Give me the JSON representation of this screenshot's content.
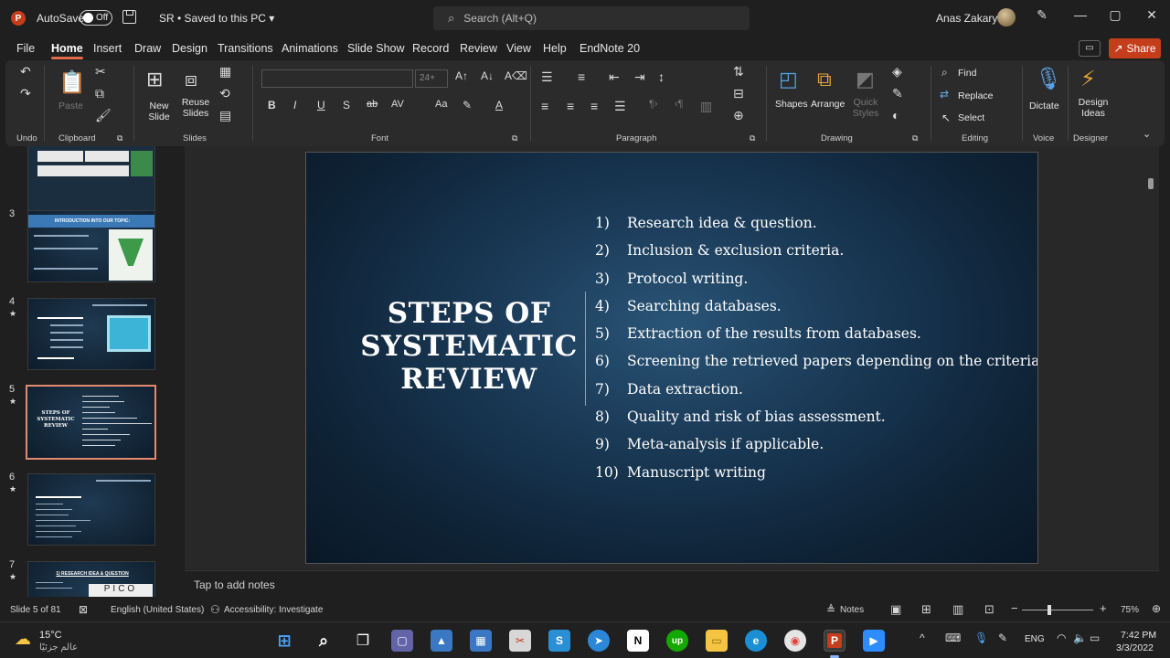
{
  "titlebar": {
    "app_logo": "P",
    "autosave_label": "AutoSave",
    "autosave_state": "Off",
    "doc_title": "SR • Saved to this PC ▾",
    "search_placeholder": "Search (Alt+Q)",
    "user_name": "Anas Zakarya"
  },
  "menu": {
    "items": [
      "File",
      "Home",
      "Insert",
      "Draw",
      "Design",
      "Transitions",
      "Animations",
      "Slide Show",
      "Record",
      "Review",
      "View",
      "Help",
      "EndNote 20"
    ],
    "active": "Home",
    "share_label": "Share"
  },
  "ribbon": {
    "groups": {
      "undo": "Undo",
      "clipboard": "Clipboard",
      "slides": "Slides",
      "font": "Font",
      "paragraph": "Paragraph",
      "drawing": "Drawing",
      "editing": "Editing",
      "voice": "Voice",
      "designer": "Designer"
    },
    "paste_label": "Paste",
    "new_slide_label": "New Slide",
    "reuse_slides_label": "Reuse Slides",
    "font_size_placeholder": "24+",
    "shapes_label": "Shapes",
    "arrange_label": "Arrange",
    "quick_styles_label": "Quick Styles",
    "find_label": "Find",
    "replace_label": "Replace",
    "select_label": "Select",
    "dictate_label": "Dictate",
    "design_ideas_label": "Design Ideas"
  },
  "thumbnails": [
    {
      "num": "",
      "title": ""
    },
    {
      "num": "3",
      "title": "INTRODUCTION INTO OUR TOPIC:"
    },
    {
      "num": "4",
      "title": ""
    },
    {
      "num": "5",
      "title": "STEPS OF SYSTEMATIC REVIEW"
    },
    {
      "num": "6",
      "title": ""
    },
    {
      "num": "7",
      "title": "1) RESEARCH IDEA & QUESTION"
    }
  ],
  "slide": {
    "title_lines": [
      "STEPS OF",
      "SYSTEMATIC",
      "REVIEW"
    ],
    "steps": [
      {
        "num": "1)",
        "text": "Research idea & question."
      },
      {
        "num": "2)",
        "text": "Inclusion & exclusion criteria."
      },
      {
        "num": "3)",
        "text": "Protocol writing."
      },
      {
        "num": "4)",
        "text": "Searching databases."
      },
      {
        "num": "5)",
        "text": "Extraction of the results from databases."
      },
      {
        "num": "6)",
        "text": "Screening the retrieved papers depending on the criteria."
      },
      {
        "num": "7)",
        "text": "Data extraction."
      },
      {
        "num": "8)",
        "text": "Quality and risk of bias assessment."
      },
      {
        "num": "9)",
        "text": "Meta-analysis if applicable."
      },
      {
        "num": "10)",
        "text": "Manuscript writing"
      }
    ]
  },
  "notes_placeholder": "Tap to add notes",
  "statusbar": {
    "slide_info": "Slide 5 of 81",
    "language": "English (United States)",
    "accessibility": "Accessibility: Investigate",
    "notes_label": "Notes",
    "zoom": "75%"
  },
  "taskbar": {
    "weather_temp": "15°C",
    "weather_desc": "عالم جزئيًا",
    "language": "ENG",
    "time": "7:42 PM",
    "date": "3/3/2022"
  },
  "colors": {
    "accent": "#c43e1c",
    "slide_bg": "#1a3a57",
    "selected_thumb": "#e28a6e"
  }
}
